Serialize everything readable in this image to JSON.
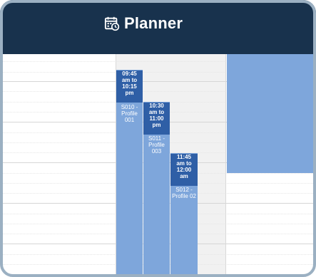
{
  "header": {
    "title": "Planner",
    "icon": "calendar-clock-icon",
    "background": "#18324d"
  },
  "events": [
    {
      "time": "09:45 am to 10:15 pm",
      "time_lines": [
        "09:45",
        "am to",
        "10:15",
        "pm"
      ],
      "label_lines": [
        "S010 -",
        "Profile",
        "001"
      ],
      "label": "S010 - Profile 001"
    },
    {
      "time": "10:30 am to 11:00 pm",
      "time_lines": [
        "10:30",
        "am to",
        "11:00",
        "pm"
      ],
      "label_lines": [
        "S011 -",
        "Profile",
        "003"
      ],
      "label": "S011 - Profile 003"
    },
    {
      "time": "11:45 am to 12:00 am",
      "time_lines": [
        "11:45",
        "am to",
        "12:00",
        "am"
      ],
      "label_lines": [
        "S012 -",
        "Profile 02"
      ],
      "label": "S012 - Profile 02"
    }
  ],
  "colors": {
    "event_header": "#2f5fa6",
    "event_body": "#7ea6db",
    "today_column": "#f1f1f1"
  }
}
